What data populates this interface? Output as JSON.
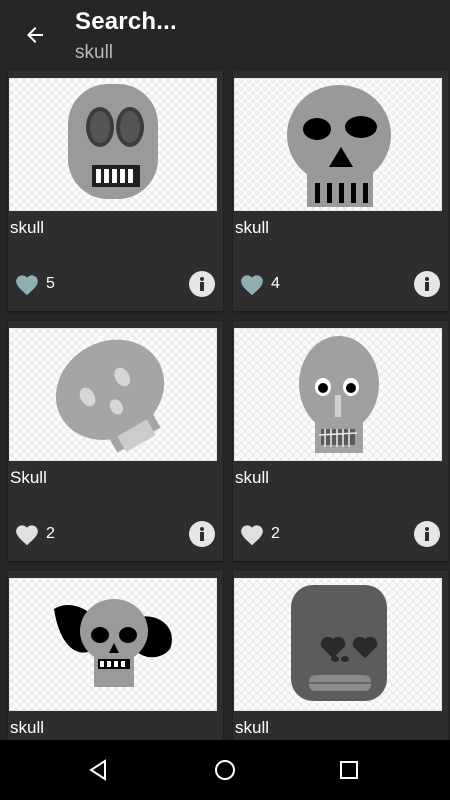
{
  "toolbar": {
    "title": "Search...",
    "subtitle": "skull",
    "back_icon": "arrow-back-icon"
  },
  "results": [
    {
      "title": "skull",
      "likes": "5",
      "liked": true,
      "heart_color": "#8fb0b0"
    },
    {
      "title": "skull",
      "likes": "4",
      "liked": true,
      "heart_color": "#8fb0b0"
    },
    {
      "title": "Skull",
      "likes": "2",
      "liked": false,
      "heart_color": "#e0e0e0"
    },
    {
      "title": "skull",
      "likes": "2",
      "liked": false,
      "heart_color": "#e0e0e0"
    },
    {
      "title": "skull",
      "likes": "",
      "liked": false,
      "heart_color": "#e0e0e0"
    },
    {
      "title": "skull",
      "likes": "",
      "liked": false,
      "heart_color": "#e0e0e0"
    }
  ],
  "navbar": {
    "back_icon": "nav-back-icon",
    "home_icon": "nav-home-icon",
    "recents_icon": "nav-recents-icon"
  }
}
